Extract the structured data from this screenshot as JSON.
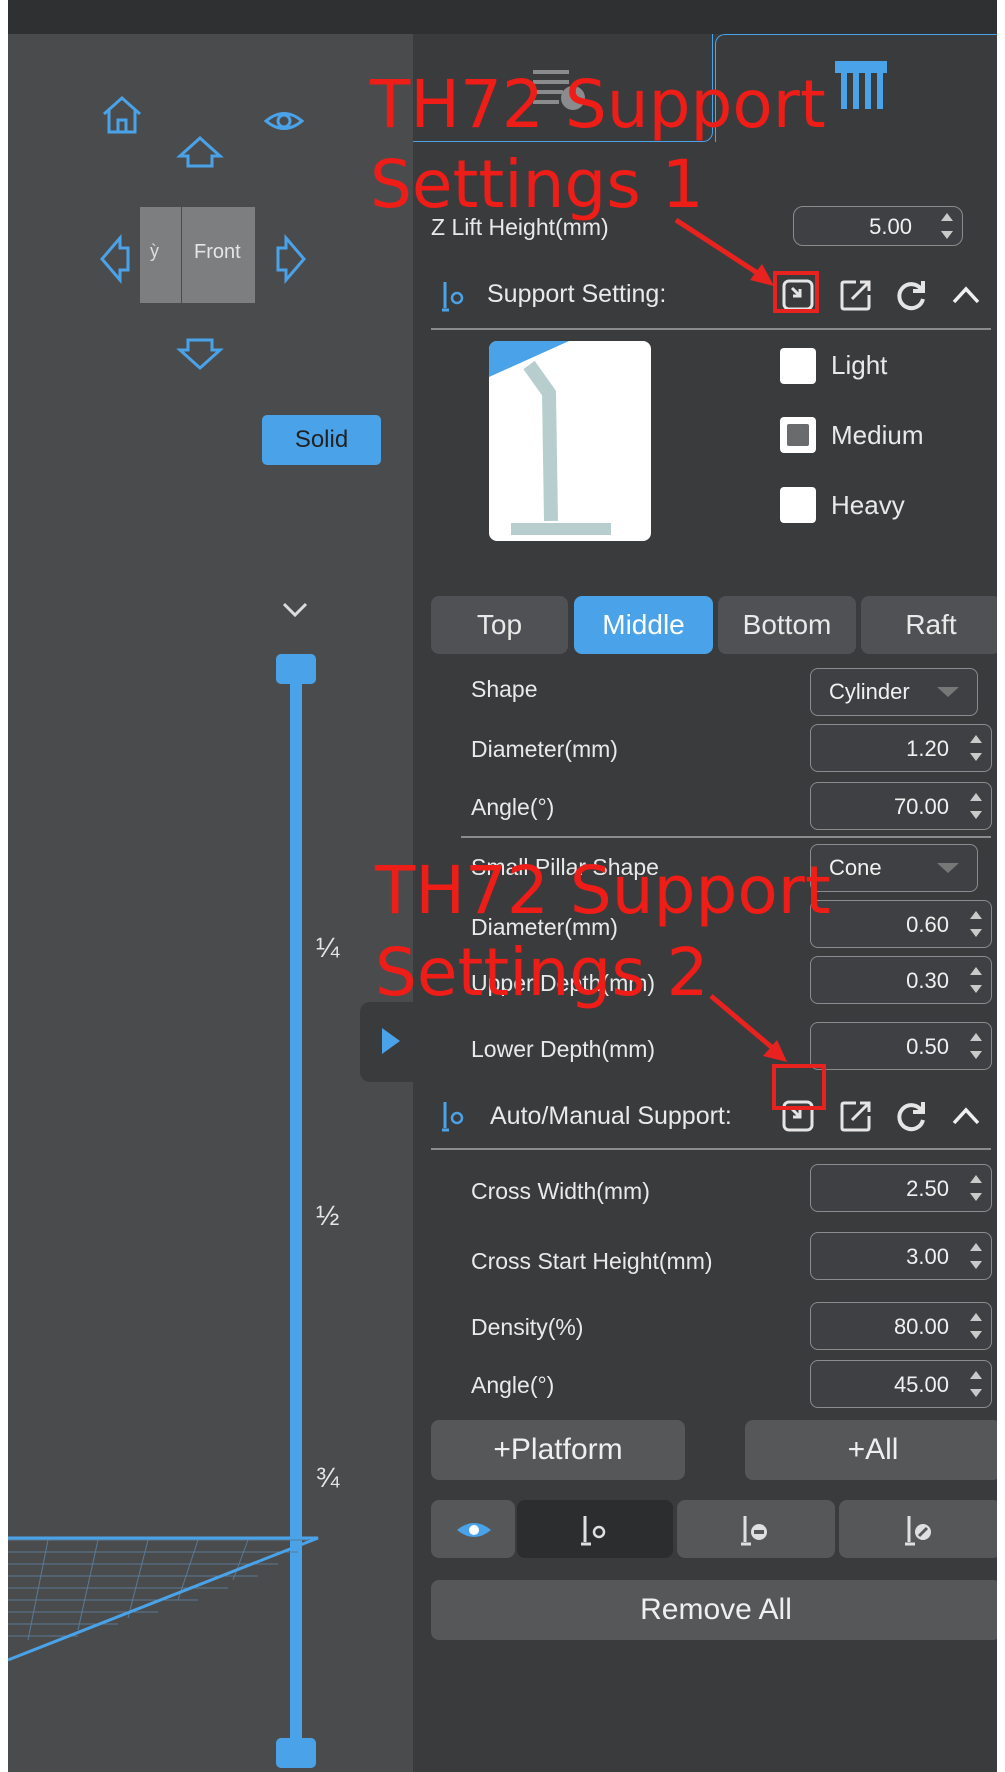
{
  "viewcube": {
    "front_label": "Front",
    "side_label": "ỳ"
  },
  "render_mode": {
    "solid_label": "Solid"
  },
  "slider": {
    "marks": [
      "¼",
      "½",
      "¾"
    ]
  },
  "z_lift": {
    "label": "Z Lift Height(mm)",
    "value": "5.00"
  },
  "support_setting": {
    "label": "Support Setting:"
  },
  "density_options": [
    {
      "label": "Light",
      "checked": false
    },
    {
      "label": "Medium",
      "checked": true
    },
    {
      "label": "Heavy",
      "checked": false
    }
  ],
  "tabs": [
    {
      "label": "Top",
      "active": false
    },
    {
      "label": "Middle",
      "active": true
    },
    {
      "label": "Bottom",
      "active": false
    },
    {
      "label": "Raft",
      "active": false
    }
  ],
  "middle": {
    "shape_label": "Shape",
    "shape_value": "Cylinder",
    "diameter_label": "Diameter(mm)",
    "diameter_value": "1.20",
    "angle_label": "Angle(°)",
    "angle_value": "70.00",
    "pillar_label": "Small Pillar Shape",
    "pillar_value": "Cone",
    "pillar_diameter_label": "Diameter(mm)",
    "pillar_diameter_value": "0.60",
    "upper_depth_label": "Upper Depth(mm)",
    "upper_depth_value": "0.30",
    "lower_depth_label": "Lower Depth(mm)",
    "lower_depth_value": "0.50"
  },
  "auto_manual": {
    "label": "Auto/Manual Support:",
    "cross_width_label": "Cross Width(mm)",
    "cross_width_value": "2.50",
    "cross_start_label": "Cross Start Height(mm)",
    "cross_start_value": "3.00",
    "density_label": "Density(%)",
    "density_value": "80.00",
    "angle_label": "Angle(°)",
    "angle_value": "45.00"
  },
  "buttons": {
    "platform": "+Platform",
    "all": "+All",
    "remove_all": "Remove All"
  },
  "annotations": {
    "label1_line1": "TH72 Support",
    "label1_line2": "Settings 1",
    "label2_line1": "TH72 Support",
    "label2_line2": "Settings 2"
  },
  "colors": {
    "accent": "#4aa3e8",
    "annotation": "#ee1d18",
    "panel": "#3a3b3d",
    "viewport": "#4a4b4d"
  }
}
